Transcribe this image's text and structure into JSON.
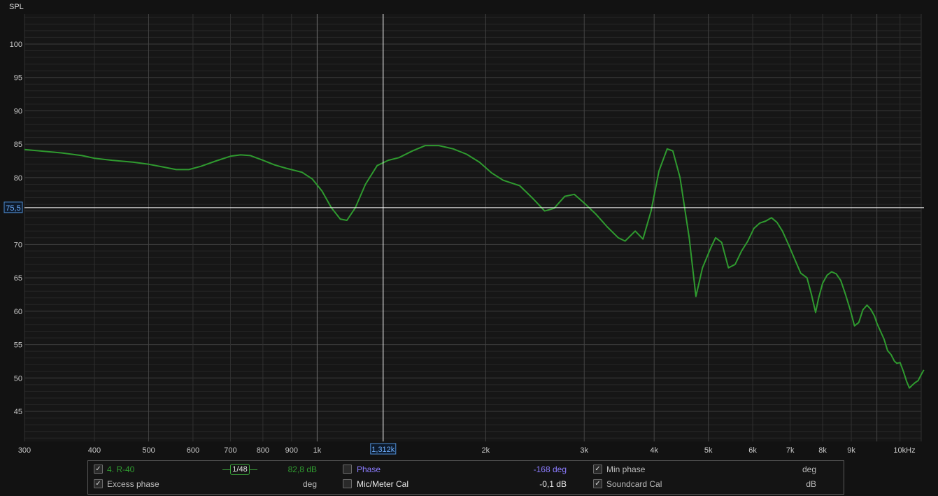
{
  "chart_data": {
    "type": "line",
    "ylabel": "SPL",
    "x_scale": "log",
    "xlim": [
      300,
      10000
    ],
    "ylim": [
      40.5,
      104.5
    ],
    "yticks": [
      45,
      50,
      55,
      60,
      65,
      70,
      75,
      80,
      85,
      90,
      95,
      100
    ],
    "ytick_labels": [
      "45",
      "50",
      "55",
      "60",
      "65",
      "70",
      "",
      "80",
      "85",
      "90",
      "95",
      "100"
    ],
    "xticks": [
      300,
      400,
      500,
      600,
      700,
      800,
      900,
      1000,
      2000,
      3000,
      4000,
      5000,
      6000,
      7000,
      8000,
      9000,
      10000
    ],
    "xtick_labels": [
      "300",
      "400",
      "500",
      "600",
      "700",
      "800",
      "900",
      "1k",
      "",
      "2k",
      "3k",
      "4k",
      "5k",
      "6k",
      "7k",
      "8k",
      "9k",
      "10kHz"
    ],
    "grid": true,
    "cursor": {
      "x": 1312,
      "y": 75.5,
      "x_label": "1,312k",
      "y_label": "75,5"
    },
    "series": [
      {
        "name": "4. R-40",
        "color": "#2f9a2f",
        "points": [
          [
            300,
            84.2
          ],
          [
            320,
            84.0
          ],
          [
            350,
            83.7
          ],
          [
            380,
            83.3
          ],
          [
            400,
            82.9
          ],
          [
            430,
            82.6
          ],
          [
            470,
            82.3
          ],
          [
            500,
            82.0
          ],
          [
            530,
            81.6
          ],
          [
            560,
            81.2
          ],
          [
            590,
            81.2
          ],
          [
            620,
            81.7
          ],
          [
            660,
            82.5
          ],
          [
            700,
            83.2
          ],
          [
            730,
            83.4
          ],
          [
            760,
            83.3
          ],
          [
            800,
            82.6
          ],
          [
            840,
            81.9
          ],
          [
            880,
            81.4
          ],
          [
            940,
            80.8
          ],
          [
            980,
            79.8
          ],
          [
            1020,
            78.0
          ],
          [
            1060,
            75.5
          ],
          [
            1100,
            73.8
          ],
          [
            1130,
            73.6
          ],
          [
            1170,
            75.5
          ],
          [
            1220,
            79.0
          ],
          [
            1280,
            81.8
          ],
          [
            1340,
            82.6
          ],
          [
            1400,
            83.0
          ],
          [
            1480,
            84.0
          ],
          [
            1560,
            84.8
          ],
          [
            1650,
            84.8
          ],
          [
            1750,
            84.3
          ],
          [
            1850,
            83.5
          ],
          [
            1950,
            82.3
          ],
          [
            2050,
            80.7
          ],
          [
            2150,
            79.6
          ],
          [
            2300,
            78.8
          ],
          [
            2420,
            77.0
          ],
          [
            2550,
            75.0
          ],
          [
            2650,
            75.4
          ],
          [
            2770,
            77.2
          ],
          [
            2880,
            77.5
          ],
          [
            3000,
            76.2
          ],
          [
            3150,
            74.5
          ],
          [
            3300,
            72.6
          ],
          [
            3450,
            71.0
          ],
          [
            3550,
            70.5
          ],
          [
            3700,
            72.0
          ],
          [
            3820,
            70.8
          ],
          [
            3950,
            75.0
          ],
          [
            4080,
            81.0
          ],
          [
            4220,
            84.3
          ],
          [
            4320,
            84.0
          ],
          [
            4450,
            80.0
          ],
          [
            4620,
            71.0
          ],
          [
            4750,
            62.2
          ],
          [
            4880,
            66.5
          ],
          [
            5050,
            69.5
          ],
          [
            5150,
            71.0
          ],
          [
            5280,
            70.3
          ],
          [
            5430,
            66.5
          ],
          [
            5580,
            67.0
          ],
          [
            5730,
            69.0
          ],
          [
            5880,
            70.5
          ],
          [
            6030,
            72.4
          ],
          [
            6180,
            73.2
          ],
          [
            6330,
            73.5
          ],
          [
            6480,
            74.0
          ],
          [
            6630,
            73.3
          ],
          [
            6780,
            72.0
          ],
          [
            6950,
            70.0
          ],
          [
            7130,
            67.8
          ],
          [
            7310,
            65.7
          ],
          [
            7500,
            65.0
          ],
          [
            7640,
            62.5
          ],
          [
            7770,
            59.8
          ],
          [
            7870,
            62.0
          ],
          [
            8000,
            64.2
          ],
          [
            8150,
            65.4
          ],
          [
            8300,
            65.9
          ],
          [
            8460,
            65.6
          ],
          [
            8620,
            64.6
          ],
          [
            8790,
            62.5
          ],
          [
            8960,
            60.2
          ],
          [
            9120,
            57.8
          ],
          [
            9280,
            58.3
          ],
          [
            9440,
            60.2
          ],
          [
            9600,
            60.9
          ],
          [
            9750,
            60.3
          ],
          [
            9900,
            59.3
          ],
          [
            10000,
            58.2
          ],
          [
            10150,
            57.0
          ],
          [
            10300,
            55.8
          ],
          [
            10450,
            54.1
          ],
          [
            10600,
            53.5
          ],
          [
            10750,
            52.5
          ],
          [
            10850,
            52.2
          ],
          [
            11000,
            52.3
          ],
          [
            11150,
            51.0
          ],
          [
            11300,
            49.5
          ],
          [
            11430,
            48.5
          ],
          [
            11560,
            48.9
          ],
          [
            11700,
            49.3
          ],
          [
            11850,
            49.6
          ],
          [
            12000,
            50.5
          ],
          [
            12130,
            51.2
          ]
        ]
      }
    ]
  },
  "legend": {
    "rows": [
      [
        {
          "checked": true,
          "label": "4. R-40",
          "color": "#2f9a2f",
          "smoothing": "1/48",
          "value": "82,8 dB",
          "value_color": "#2f9a2f"
        },
        {
          "checked": false,
          "label": "Phase",
          "color": "#8c7cff",
          "value": "-168 deg",
          "value_color": "#8c7cff"
        },
        {
          "checked": true,
          "label": "Min phase",
          "color": "#bdbdbd",
          "value": "deg",
          "value_color": "#bdbdbd"
        }
      ],
      [
        {
          "checked": true,
          "label": "Excess phase",
          "color": "#bdbdbd",
          "value": "deg",
          "value_color": "#bdbdbd"
        },
        {
          "checked": false,
          "label": "Mic/Meter Cal",
          "color": "#e8e8e8",
          "value": "-0,1 dB",
          "value_color": "#e8e8e8"
        },
        {
          "checked": true,
          "label": "Soundcard Cal",
          "color": "#bdbdbd",
          "value": "dB",
          "value_color": "#bdbdbd"
        }
      ]
    ]
  }
}
